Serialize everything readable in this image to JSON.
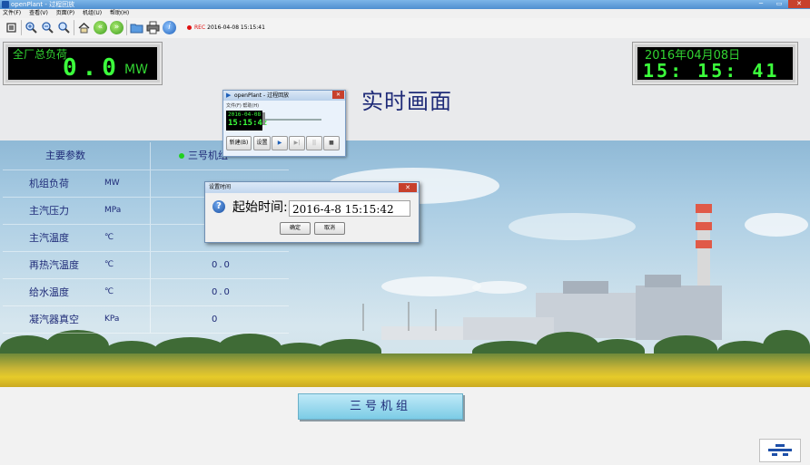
{
  "window": {
    "title": "openPlant - 过程回放",
    "min_label": "─",
    "max_label": "▭",
    "close_label": "✕"
  },
  "menu": [
    "文件(F)",
    "查看(V)",
    "页面(P)",
    "机组(U)",
    "帮助(H)"
  ],
  "toolbar": {
    "rec_label": "REC",
    "rec_time": "2016-04-08 15:15:41"
  },
  "header": {
    "total_load_label": "全厂总负荷",
    "total_load_value": "0.0",
    "total_load_unit": "MW",
    "date_display": "2016年04月08日",
    "time_display": "15: 15: 41",
    "page_title": "实时画面"
  },
  "params": {
    "header_name": "主要参数",
    "header_unit": "三号机组",
    "rows": [
      {
        "name": "机组负荷",
        "unit": "MW",
        "value": ""
      },
      {
        "name": "主汽压力",
        "unit": "MPa",
        "value": ""
      },
      {
        "name": "主汽温度",
        "unit": "℃",
        "value": ""
      },
      {
        "name": "再热汽温度",
        "unit": "℃",
        "value": "0.0"
      },
      {
        "name": "给水温度",
        "unit": "℃",
        "value": "0.0"
      },
      {
        "name": "凝汽器真空",
        "unit": "KPa",
        "value": "0"
      }
    ]
  },
  "unit_button": "三号机组",
  "playback": {
    "title": "openPlant - 过程回放",
    "menu": "文件(F)  帮助(H)",
    "date": "2016-04-08",
    "time": "15:15:42",
    "new_label": "新建(B)",
    "settings_label": "设置",
    "play": "▶",
    "step": "▶|",
    "pause": "||",
    "stop": "■"
  },
  "dialog": {
    "title": "设置时间",
    "label": "起始时间:",
    "value": "2016-4-8  15:15:42",
    "ok": "确定",
    "cancel": "取消"
  },
  "colors": {
    "led_green": "#3cff3c",
    "title_blue": "#1f2b78",
    "accent_button": "#7ccce6"
  }
}
